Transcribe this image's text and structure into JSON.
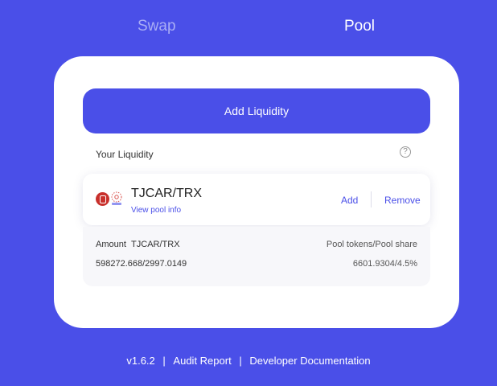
{
  "tabs": {
    "swap": "Swap",
    "pool": "Pool"
  },
  "card": {
    "add_liquidity_label": "Add Liquidity",
    "your_liquidity_label": "Your Liquidity",
    "help_glyph": "?"
  },
  "pair": {
    "name": "TJCAR/TRX",
    "view_pool_info": "View pool info",
    "add_label": "Add",
    "remove_label": "Remove",
    "amount_label": "Amount",
    "amount_pair": "TJCAR/TRX",
    "amount_value": "598272.668/2997.0149",
    "pool_label": "Pool tokens/Pool share",
    "pool_value": "6601.9304/4.5%"
  },
  "footer": {
    "version": "v1.6.2",
    "sep1": "|",
    "audit_report": "Audit Report",
    "sep2": "|",
    "developer_docs": "Developer Documentation"
  },
  "colors": {
    "background": "#4a4fe8",
    "accent": "#4a4fe8",
    "token_a": "#c8302c"
  },
  "icons": {
    "help": "question-circle-icon",
    "token_a": "tjcar-token-icon",
    "token_b": "trx-token-icon"
  }
}
